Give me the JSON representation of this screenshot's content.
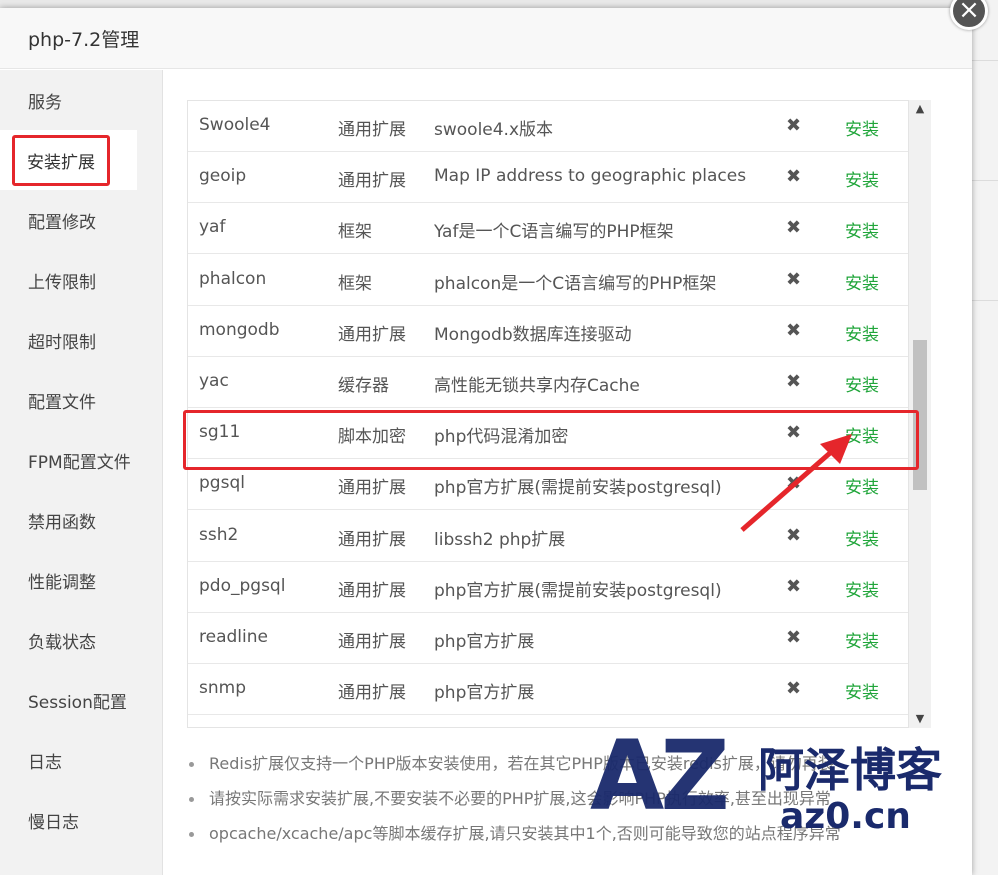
{
  "window": {
    "title": "php-7.2管理",
    "close_icon": "close-icon"
  },
  "sidebar": {
    "items": [
      {
        "label": "服务"
      },
      {
        "label": "安装扩展",
        "active": true
      },
      {
        "label": "配置修改"
      },
      {
        "label": "上传限制"
      },
      {
        "label": "超时限制"
      },
      {
        "label": "配置文件"
      },
      {
        "label": "FPM配置文件"
      },
      {
        "label": "禁用函数"
      },
      {
        "label": "性能调整"
      },
      {
        "label": "负载状态"
      },
      {
        "label": "Session配置"
      },
      {
        "label": "日志"
      },
      {
        "label": "慢日志"
      }
    ]
  },
  "extensions": {
    "rows": [
      {
        "name": "Swoole4",
        "type": "通用扩展",
        "desc": "swoole4.x版本",
        "status": "✖",
        "action": "安装"
      },
      {
        "name": "geoip",
        "type": "通用扩展",
        "desc": "Map IP address to geographic places",
        "status": "✖",
        "action": "安装"
      },
      {
        "name": "yaf",
        "type": "框架",
        "desc": "Yaf是一个C语言编写的PHP框架",
        "status": "✖",
        "action": "安装"
      },
      {
        "name": "phalcon",
        "type": "框架",
        "desc": "phalcon是一个C语言编写的PHP框架",
        "status": "✖",
        "action": "安装"
      },
      {
        "name": "mongodb",
        "type": "通用扩展",
        "desc": "Mongodb数据库连接驱动",
        "status": "✖",
        "action": "安装"
      },
      {
        "name": "yac",
        "type": "缓存器",
        "desc": "高性能无锁共享内存Cache",
        "status": "✖",
        "action": "安装"
      },
      {
        "name": "sg11",
        "type": "脚本加密",
        "desc": "php代码混淆加密",
        "status": "✖",
        "action": "安装"
      },
      {
        "name": "pgsql",
        "type": "通用扩展",
        "desc": "php官方扩展(需提前安装postgresql)",
        "status": "✖",
        "action": "安装"
      },
      {
        "name": "ssh2",
        "type": "通用扩展",
        "desc": "libssh2 php扩展",
        "status": "✖",
        "action": "安装"
      },
      {
        "name": "pdo_pgsql",
        "type": "通用扩展",
        "desc": "php官方扩展(需提前安装postgresql)",
        "status": "✖",
        "action": "安装"
      },
      {
        "name": "readline",
        "type": "通用扩展",
        "desc": "php官方扩展",
        "status": "✖",
        "action": "安装"
      },
      {
        "name": "snmp",
        "type": "通用扩展",
        "desc": "php官方扩展",
        "status": "✖",
        "action": "安装"
      }
    ]
  },
  "notes": [
    "Redis扩展仅支持一个PHP版本安装使用，若在其它PHP版本已安装redis扩展，请勿再装",
    "请按实际需求安装扩展,不要安装不必要的PHP扩展,这会影响PHP执行效率,甚至出现异常",
    "opcache/xcache/apc等脚本缓存扩展,请只安装其中1个,否则可能导致您的站点程序异常"
  ],
  "watermark": {
    "logo": "AZ",
    "name": "阿泽博客",
    "url": "az0.cn"
  },
  "colors": {
    "install_green": "#20a53a",
    "highlight_red": "#e5262b",
    "watermark_blue": "#1a2a6c"
  }
}
